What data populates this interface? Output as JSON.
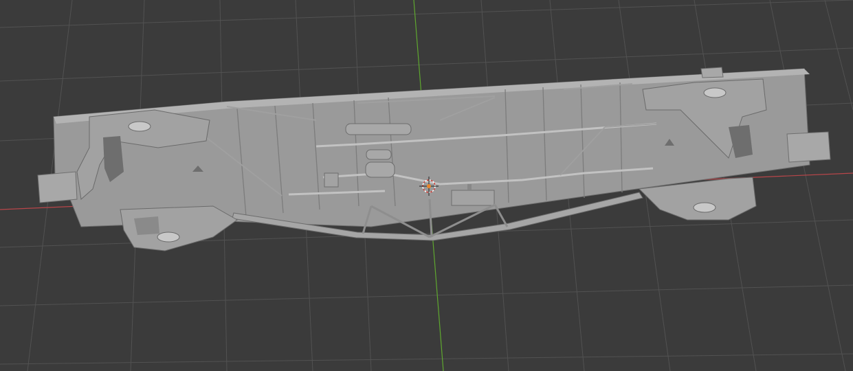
{
  "viewport": {
    "background_color": "#3b3b3b",
    "grid_color": "#555555",
    "x_axis_color": "#b9464a",
    "y_axis_color": "#5fa82f",
    "model_color": "#9a9a9a",
    "model_shadow_color": "#7a7a7a",
    "model_highlight_color": "#b0b0b0",
    "origin_marker_color": "#e8842a"
  },
  "objects": [
    {
      "name": "railcar-underframe",
      "icon": "mesh-object"
    },
    {
      "name": "3d-cursor",
      "icon": "crosshair-icon"
    }
  ]
}
